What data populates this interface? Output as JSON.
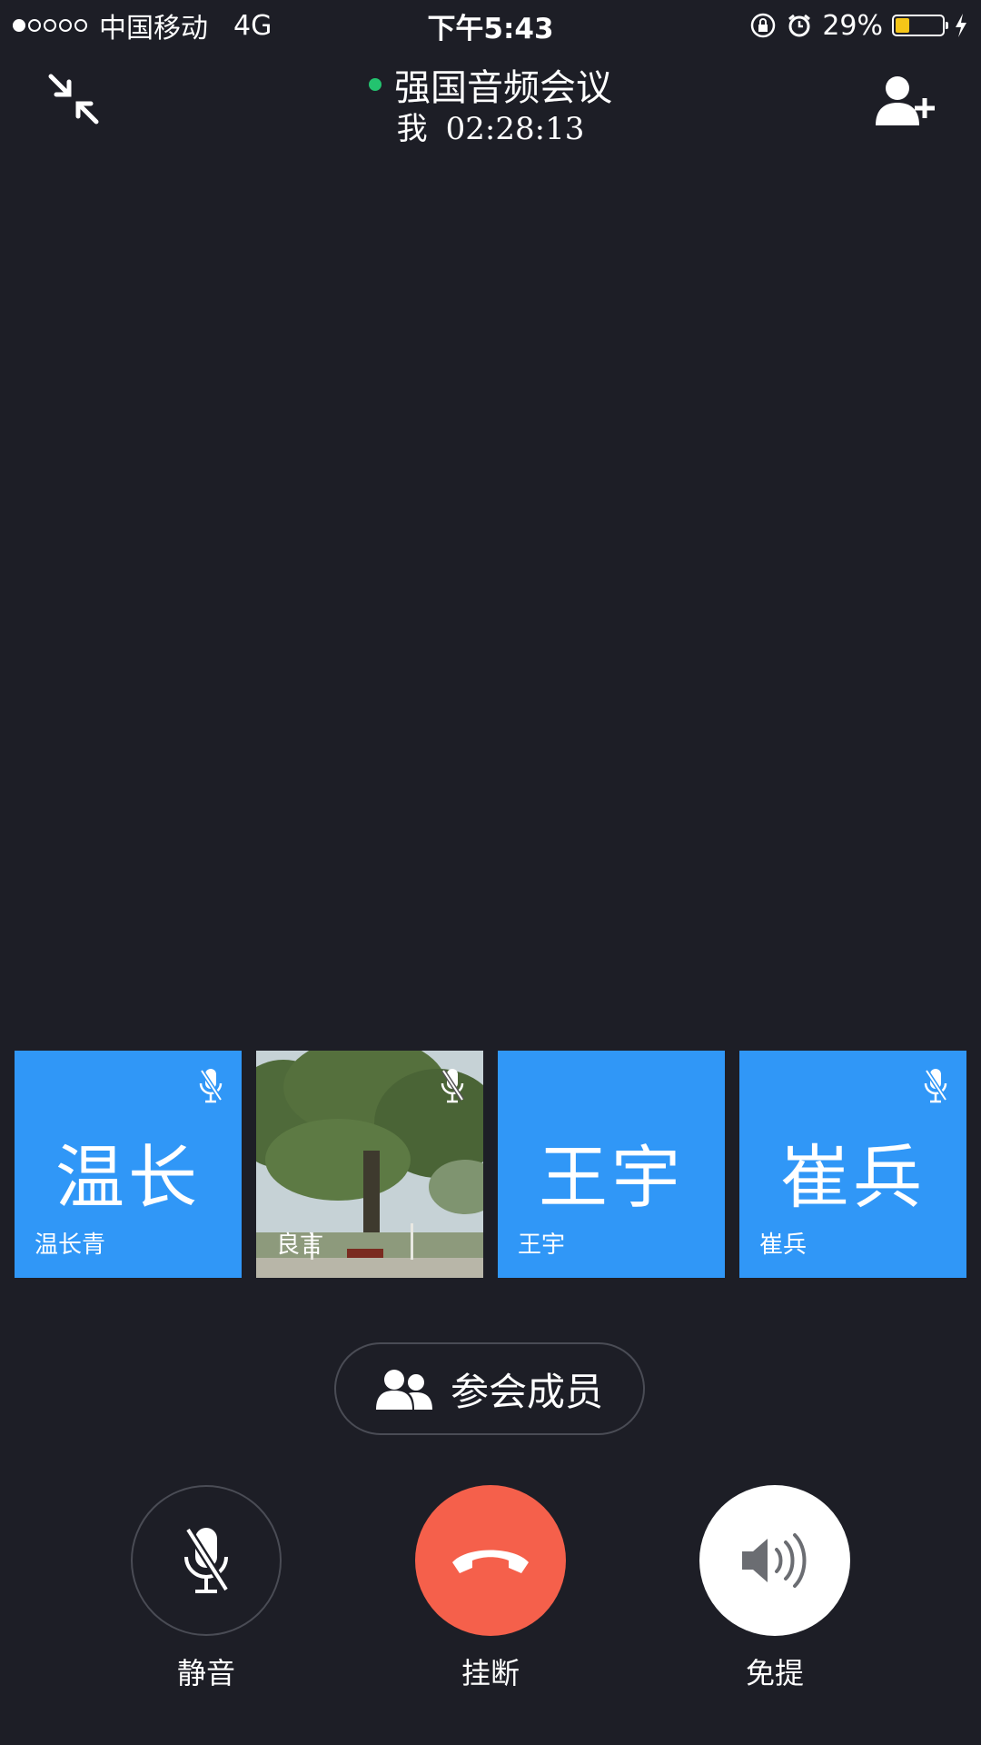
{
  "status_bar": {
    "carrier": "中国移动",
    "network": "4G",
    "time": "下午5:43",
    "battery_percent": "29%",
    "battery_level": 0.29,
    "icons": [
      "orientation-lock-icon",
      "alarm-icon",
      "battery-icon",
      "charging-icon"
    ]
  },
  "header": {
    "title": "强国音频会议",
    "speaker": "我",
    "duration": "02:28:13",
    "live_color": "#23c36f"
  },
  "participants": [
    {
      "avatar_text": "温长",
      "name": "温长青",
      "muted": true
    },
    {
      "avatar_text": "",
      "name": "良言",
      "muted": true,
      "photo": true
    },
    {
      "avatar_text": "王宇",
      "name": "王宇",
      "muted": false
    },
    {
      "avatar_text": "崔兵",
      "name": "崔兵",
      "muted": true
    }
  ],
  "members_button": {
    "label": "参会成员"
  },
  "controls": {
    "mute_label": "静音",
    "hangup_label": "挂断",
    "speaker_label": "免提"
  },
  "colors": {
    "background": "#1d1e26",
    "tile": "#3097f7",
    "hangup": "#f5604b"
  }
}
